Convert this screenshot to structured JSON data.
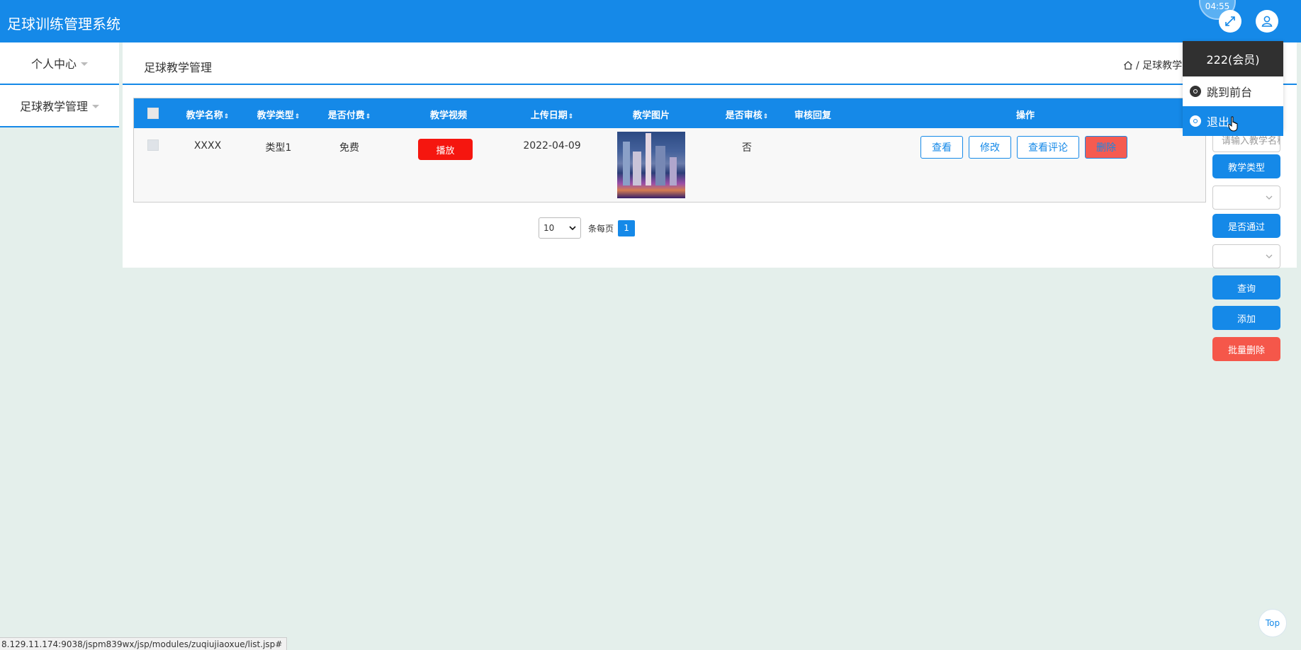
{
  "header": {
    "app_title": "足球训练管理系统",
    "clock": "04:55"
  },
  "sidebar": {
    "items": [
      {
        "label": "个人中心"
      },
      {
        "label": "足球教学管理"
      }
    ]
  },
  "panel": {
    "title": "足球教学管理",
    "breadcrumb": "/ 足球教学管理"
  },
  "table": {
    "columns": [
      {
        "label": "教学名称",
        "sortable": true
      },
      {
        "label": "教学类型",
        "sortable": true
      },
      {
        "label": "是否付费",
        "sortable": true
      },
      {
        "label": "教学视频",
        "sortable": false
      },
      {
        "label": "上传日期",
        "sortable": true
      },
      {
        "label": "教学图片",
        "sortable": false
      },
      {
        "label": "是否审核",
        "sortable": true
      },
      {
        "label": "审核回复",
        "sortable": false
      },
      {
        "label": "操作",
        "sortable": false
      }
    ],
    "sort_icon": "⇕",
    "rows": [
      {
        "name": "XXXX",
        "type": "类型1",
        "paid": "免费",
        "video_button": "播放",
        "date": "2022-04-09",
        "reviewed": "否",
        "reply": "",
        "actions": {
          "view": "查看",
          "edit": "修改",
          "comments": "查看评论",
          "delete": "删除"
        }
      }
    ]
  },
  "pagination": {
    "page_size": "10",
    "per_page_label": "条每页",
    "current_page": "1"
  },
  "filters": {
    "search_placeholder": "请输入教学名称",
    "type_label": "教学类型",
    "pass_label": "是否通过",
    "query_button": "查询",
    "add_button": "添加",
    "batch_delete_button": "批量删除"
  },
  "user_menu": {
    "user": "222(会员)",
    "goto_front": "跳到前台",
    "logout": "退出"
  },
  "status_bar": {
    "url": "8.129.11.174:9038/jspm839wx/jsp/modules/zuqiujiaoxue/list.jsp#"
  },
  "back_to_top": "Top",
  "colors": {
    "primary": "#1589e8",
    "danger": "#f5160f",
    "soft_danger": "#f5574a",
    "background": "#e4efeb",
    "dark": "#303030"
  }
}
